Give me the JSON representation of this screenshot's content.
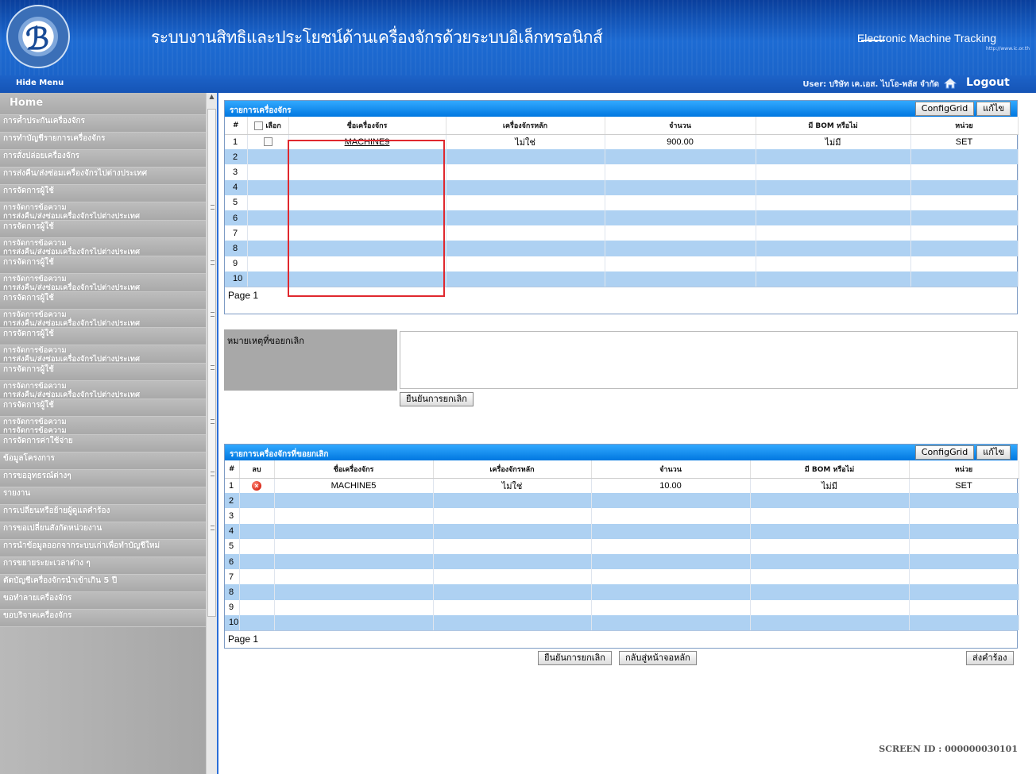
{
  "header": {
    "title": "ระบบงานสิทธิและประโยชน์ด้านเครื่องจักรด้วยระบบอิเล็กทรอนิกส์",
    "brand": "Electronic Machine Tracking",
    "brand_url": "http://www.ic.or.th"
  },
  "subbar": {
    "hide_menu": "Hide Menu",
    "user": "User: บริษัท เค.เอส. ไบโอ-พลัส จำกัด",
    "logout": "Logout"
  },
  "sidebar": {
    "items": [
      "Home",
      "การค้ำประกันเครื่องจักร",
      "การทำบัญชีรายการเครื่องจักร",
      "การสั่งปล่อยเครื่องจักร",
      "การส่งคืน/ส่งซ่อมเครื่องจักรไปต่างประเทศ",
      "การจัดการผู้ใช้",
      "การจัดการข้อความ",
      "การส่งคืน/ส่งซ่อมเครื่องจักรไปต่างประเทศ",
      "การจัดการผู้ใช้",
      "การจัดการข้อความ",
      "การส่งคืน/ส่งซ่อมเครื่องจักรไปต่างประเทศ",
      "การจัดการผู้ใช้",
      "การจัดการข้อความ",
      "การส่งคืน/ส่งซ่อมเครื่องจักรไปต่างประเทศ",
      "การจัดการผู้ใช้",
      "การจัดการข้อความ",
      "การส่งคืน/ส่งซ่อมเครื่องจักรไปต่างประเทศ",
      "การจัดการผู้ใช้",
      "การจัดการข้อความ",
      "การส่งคืน/ส่งซ่อมเครื่องจักรไปต่างประเทศ",
      "การจัดการผู้ใช้",
      "การจัดการข้อความ",
      "การส่งคืน/ส่งซ่อมเครื่องจักรไปต่างประเทศ",
      "การจัดการผู้ใช้",
      "การจัดการข้อความ",
      "การจัดการข้อความ",
      "การจัดการค่าใช้จ่าย",
      "ข้อมูลโครงการ",
      "การขออุทธรณ์ต่างๆ",
      "รายงาน",
      "การเปลี่ยนหรือย้ายผู้ดูแลคำร้อง",
      "การขอเปลี่ยนสังกัดหน่วยงาน",
      "การนำข้อมูลออกจากระบบเก่าเพื่อทำบัญชีใหม่",
      "การขยายระยะเวลาต่าง ๆ",
      "ตัดบัญชีเครื่องจักรนำเข้าเกิน 5 ปี",
      "ขอทำลายเครื่องจักร",
      "ขอบริจาคเครื่องจักร"
    ]
  },
  "grid1": {
    "title": "รายการเครื่องจักร",
    "config_label": "ConfigGrid",
    "edit_label": "แก้ไข",
    "headers": [
      "#",
      "เลือก",
      "ชื่อเครื่องจักร",
      "เครื่องจักรหลัก",
      "จำนวน",
      "มี BOM หรือไม่",
      "หน่วย"
    ],
    "rows": [
      {
        "no": "1",
        "name": "MACHINE9",
        "main": "ไม่ใช่",
        "qty": "900.00",
        "bom": "ไม่มี",
        "unit": "SET"
      },
      {
        "no": "2"
      },
      {
        "no": "3"
      },
      {
        "no": "4"
      },
      {
        "no": "5"
      },
      {
        "no": "6"
      },
      {
        "no": "7"
      },
      {
        "no": "8"
      },
      {
        "no": "9"
      },
      {
        "no": "10"
      }
    ],
    "page": "Page 1"
  },
  "reason": {
    "label": "หมายเหตุที่ขอยกเลิก",
    "value": "",
    "confirm_label": "ยืนยันการยกเลิก"
  },
  "grid2": {
    "title": "รายการเครื่องจักรที่ขอยกเลิก",
    "config_label": "ConfigGrid",
    "edit_label": "แก้ไข",
    "headers": [
      "#",
      "ลบ",
      "ชื่อเครื่องจักร",
      "เครื่องจักรหลัก",
      "จำนวน",
      "มี BOM หรือไม่",
      "หน่วย"
    ],
    "rows": [
      {
        "no": "1",
        "name": "MACHINE5",
        "main": "ไม่ใช่",
        "qty": "10.00",
        "bom": "ไม่มี",
        "unit": "SET"
      },
      {
        "no": "2"
      },
      {
        "no": "3"
      },
      {
        "no": "4"
      },
      {
        "no": "5"
      },
      {
        "no": "6"
      },
      {
        "no": "7"
      },
      {
        "no": "8"
      },
      {
        "no": "9"
      },
      {
        "no": "10"
      }
    ],
    "page": "Page 1"
  },
  "actions": {
    "confirm_label": "ยืนยันการยกเลิก",
    "back_label": "กลับสู่หน้าจอหลัก",
    "submit_label": "ส่งคำร้อง"
  },
  "footer": {
    "screen_id": "SCREEN ID : 000000030101"
  },
  "colors": {
    "header_blue": "#1b64c9",
    "grid_title": "#0a85ee",
    "row_alt": "#aed1f2",
    "highlight": "#e0282e"
  }
}
